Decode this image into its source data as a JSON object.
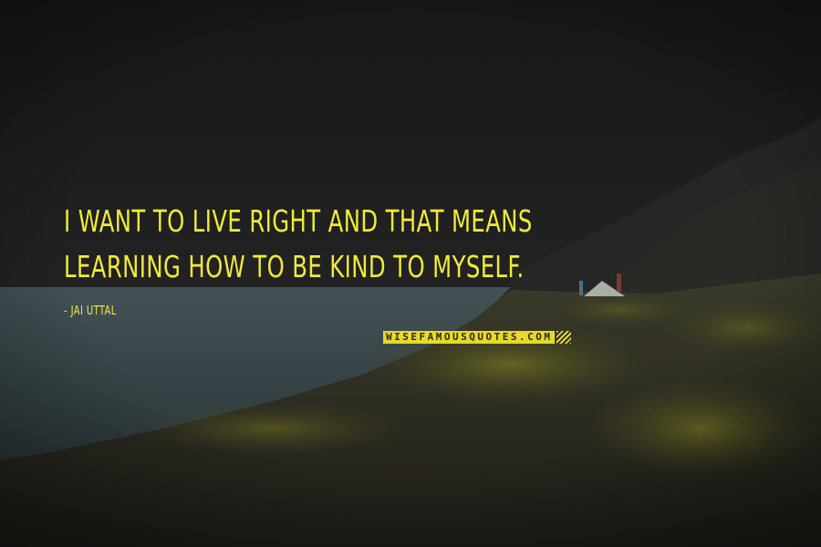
{
  "quote": {
    "text": "I WANT TO LIVE RIGHT AND THAT MEANS LEARNING HOW TO BE KIND TO MYSELF.",
    "author": "- JAI UTTAL"
  },
  "watermark": {
    "text": "WISEFAMOUSQUOTES.COM"
  },
  "colors": {
    "quote_text": "#f2ea3a",
    "watermark_bg": "#e8d82a",
    "sky": "#1b1b1b",
    "lake": "#3b4a4d",
    "grass": "#4e5224"
  }
}
